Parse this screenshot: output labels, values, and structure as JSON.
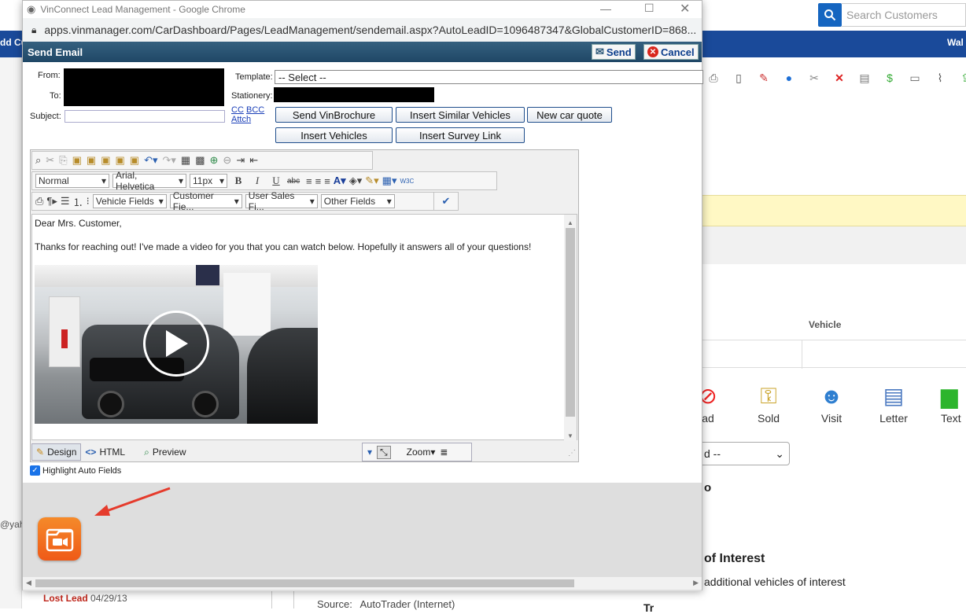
{
  "background": {
    "search_placeholder": "Search Customers",
    "left_header_text": "dd Cu",
    "right_header_text": "Wal",
    "vehicle_header": "Vehicle",
    "actions": [
      {
        "label": "ad",
        "icon": "no-entry-icon"
      },
      {
        "label": "Sold",
        "icon": "keys-icon"
      },
      {
        "label": "Visit",
        "icon": "person-icon"
      },
      {
        "label": "Letter",
        "icon": "document-icon"
      },
      {
        "label": "Text",
        "icon": "chat-icon"
      }
    ],
    "dropdown_value": "d --",
    "frag_o": "o",
    "of_interest": "of Interest",
    "additional": "additional vehicles of interest",
    "email_fragment": "@yah",
    "lost_lead_label": "Lost Lead",
    "lost_lead_date": "04/29/13",
    "source_label": "Source:",
    "source_value": "AutoTrader (Internet)",
    "bottom_right_fragment": "Tr"
  },
  "window": {
    "title": "VinConnect Lead Management - Google Chrome",
    "url": "apps.vinmanager.com/CarDashboard/Pages/LeadManagement/sendemail.aspx?AutoLeadID=1096487347&GlobalCustomerID=868..."
  },
  "dialog": {
    "title": "Send Email",
    "send_label": "Send",
    "cancel_label": "Cancel",
    "from_label": "From:",
    "to_label": "To:",
    "subject_label": "Subject:",
    "subject_value": "",
    "template_label": "Template:",
    "template_value": "-- Select --",
    "stationery_label": "Stationery:",
    "cc_label": "CC",
    "bcc_label": "BCC",
    "attach_label": "Attch",
    "buttons": {
      "send_vinbrochure": "Send VinBrochure",
      "insert_similar": "Insert Similar Vehicles",
      "new_car_quote": "New car quote",
      "insert_vehicles": "Insert Vehicles",
      "insert_survey": "Insert Survey Link"
    }
  },
  "editor": {
    "format": "Normal",
    "font": "Arial, Helvetica",
    "size": "11px",
    "vehicle_fields": "Vehicle Fields",
    "customer_fields": "Customer Fie...",
    "user_sales_fields": "User Sales Fi...",
    "other_fields": "Other Fields",
    "greeting": "Dear Mrs. Customer,",
    "body": "Thanks for reaching out! I've made a video for you that you can watch below. Hopefully it answers all of your questions!",
    "design_tab": "Design",
    "html_tab": "HTML",
    "preview_tab": "Preview",
    "zoom_label": "Zoom",
    "highlight_label": "Highlight Auto Fields",
    "highlight_checked": true
  },
  "colors": {
    "accent_blue": "#1a4a9a",
    "dialog_header": "#2a5677",
    "arrow_red": "#e53b2c",
    "app_icon_orange": "#f26b1d"
  }
}
